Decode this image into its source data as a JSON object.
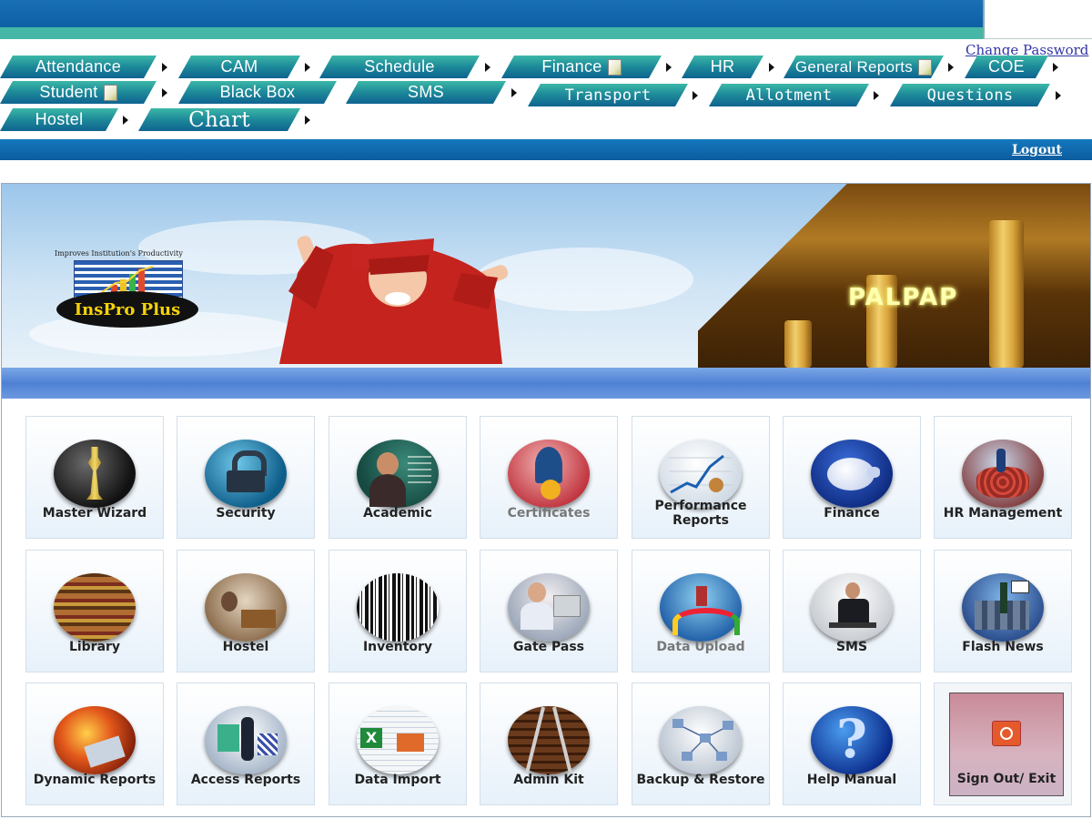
{
  "header": {
    "change_password": "Change Password",
    "logout": "Logout"
  },
  "nav": {
    "tabs": [
      {
        "label": "Attendance",
        "has_doc_icon": false
      },
      {
        "label": "CAM",
        "has_doc_icon": false
      },
      {
        "label": "Schedule",
        "has_doc_icon": false
      },
      {
        "label": "Finance",
        "has_doc_icon": true
      },
      {
        "label": "HR",
        "has_doc_icon": false
      },
      {
        "label": "General Reports",
        "has_doc_icon": true
      },
      {
        "label": "COE",
        "has_doc_icon": false
      },
      {
        "label": "Student",
        "has_doc_icon": true
      },
      {
        "label": "Black Box",
        "has_doc_icon": false
      },
      {
        "label": "SMS",
        "has_doc_icon": false
      },
      {
        "label": "Transport",
        "has_doc_icon": false
      },
      {
        "label": "Allotment",
        "has_doc_icon": false
      },
      {
        "label": "Questions",
        "has_doc_icon": false
      },
      {
        "label": "Hostel",
        "has_doc_icon": false
      },
      {
        "label": "Chart",
        "has_doc_icon": false
      }
    ]
  },
  "banner": {
    "logo_tagline": "Improves Institution's Productivity",
    "logo_name": "InsPro Plus",
    "brand": "PALPAP"
  },
  "modules": [
    {
      "label": "Master Wizard",
      "icon": "chess-king-icon"
    },
    {
      "label": "Security",
      "icon": "lock-icon"
    },
    {
      "label": "Academic",
      "icon": "teacher-icon"
    },
    {
      "label": "Certificates",
      "icon": "certificate-icon",
      "dimmed": true
    },
    {
      "label": "Performance Reports",
      "icon": "performance-chart-icon"
    },
    {
      "label": "Finance",
      "icon": "piggy-bank-icon"
    },
    {
      "label": "HR Management",
      "icon": "hr-people-icon"
    },
    {
      "label": "Library",
      "icon": "bookshelf-icon"
    },
    {
      "label": "Hostel",
      "icon": "hostel-room-icon"
    },
    {
      "label": "Inventory",
      "icon": "barcode-icon"
    },
    {
      "label": "Gate Pass",
      "icon": "receptionist-icon"
    },
    {
      "label": "Data Upload",
      "icon": "upload-icon",
      "dimmed": true
    },
    {
      "label": "SMS",
      "icon": "phone-user-icon"
    },
    {
      "label": "Flash News",
      "icon": "news-icon"
    },
    {
      "label": "Dynamic Reports",
      "icon": "fire-report-icon"
    },
    {
      "label": "Access Reports",
      "icon": "access-report-icon"
    },
    {
      "label": "Data Import",
      "icon": "spreadsheet-icon"
    },
    {
      "label": "Admin Kit",
      "icon": "rail-track-icon"
    },
    {
      "label": "Backup & Restore",
      "icon": "network-icon"
    },
    {
      "label": "Help Manual",
      "icon": "question-mark-icon"
    },
    {
      "label": "Sign Out/ Exit",
      "icon": "power-icon"
    }
  ],
  "colors": {
    "header_blue": "#0d5fa4",
    "header_teal": "#46b6a6",
    "tab_gradient_top": "#3cb8a8",
    "tab_gradient_bottom": "#0e6390",
    "banner_bar": "#4f81d4"
  }
}
